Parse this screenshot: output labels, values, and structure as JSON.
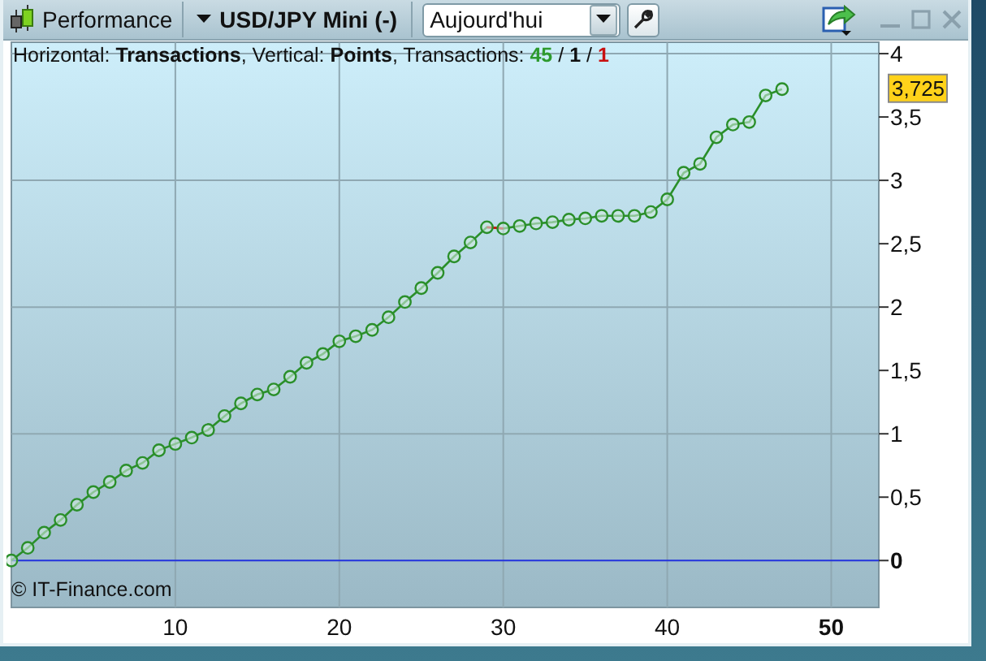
{
  "window": {
    "title": "Performance"
  },
  "toolbar": {
    "instrument": "USD/JPY Mini (-)",
    "period": {
      "value": "Aujourd'hui"
    }
  },
  "info": {
    "horizontal": "Horizontal:",
    "vertical": ", Vertical:",
    "count_label": ", Transactions:",
    "separator": "/",
    "counts": [
      {
        "value": "45",
        "color": "#2e9a2e"
      },
      {
        "value": "1",
        "color": "#111111"
      },
      {
        "value": "1",
        "color": "#c81010"
      }
    ]
  },
  "copyright": "© IT-Finance.com",
  "current_value": "3,725",
  "chart_data": {
    "type": "line",
    "xlabel": "Transactions",
    "ylabel": "Points",
    "grid": true,
    "x": [
      0,
      1,
      2,
      3,
      4,
      5,
      6,
      7,
      8,
      9,
      10,
      11,
      12,
      13,
      14,
      15,
      16,
      17,
      18,
      19,
      20,
      21,
      22,
      23,
      24,
      25,
      26,
      27,
      28,
      29,
      30,
      31,
      32,
      33,
      34,
      35,
      36,
      37,
      38,
      39,
      40,
      41,
      42,
      43,
      44,
      45,
      46,
      47
    ],
    "series": [
      {
        "color": "#2a8f2a",
        "marker": "o",
        "values": [
          0,
          0.1,
          0.22,
          0.32,
          0.44,
          0.54,
          0.62,
          0.71,
          0.77,
          0.87,
          0.92,
          0.97,
          1.03,
          1.14,
          1.24,
          1.31,
          1.35,
          1.45,
          1.56,
          1.63,
          1.73,
          1.77,
          1.82,
          1.92,
          2.04,
          2.15,
          2.27,
          2.4,
          2.51,
          2.63,
          2.62,
          2.64,
          2.66,
          2.67,
          2.69,
          2.7,
          2.72,
          2.72,
          2.72,
          2.75,
          2.85,
          3.06,
          3.13,
          3.34,
          3.44,
          3.46,
          3.67,
          3.72
        ]
      }
    ],
    "xlim": [
      0,
      52.9
    ],
    "ylim": [
      -0.37,
      4.09
    ],
    "ref_lines": [
      {
        "axis": "y",
        "value": 0,
        "color": "#2233dd"
      }
    ],
    "xticks": [
      10,
      20,
      30,
      40,
      50
    ],
    "yticks": [
      {
        "value": 0,
        "label": "0"
      },
      {
        "value": 0.5,
        "label": "0,5"
      },
      {
        "value": 1,
        "label": "1"
      },
      {
        "value": 1.5,
        "label": "1,5"
      },
      {
        "value": 2,
        "label": "2"
      },
      {
        "value": 2.5,
        "label": "2,5"
      },
      {
        "value": 3,
        "label": "3"
      },
      {
        "value": 3.5,
        "label": "3,5"
      },
      {
        "value": 4,
        "label": "4"
      }
    ]
  }
}
